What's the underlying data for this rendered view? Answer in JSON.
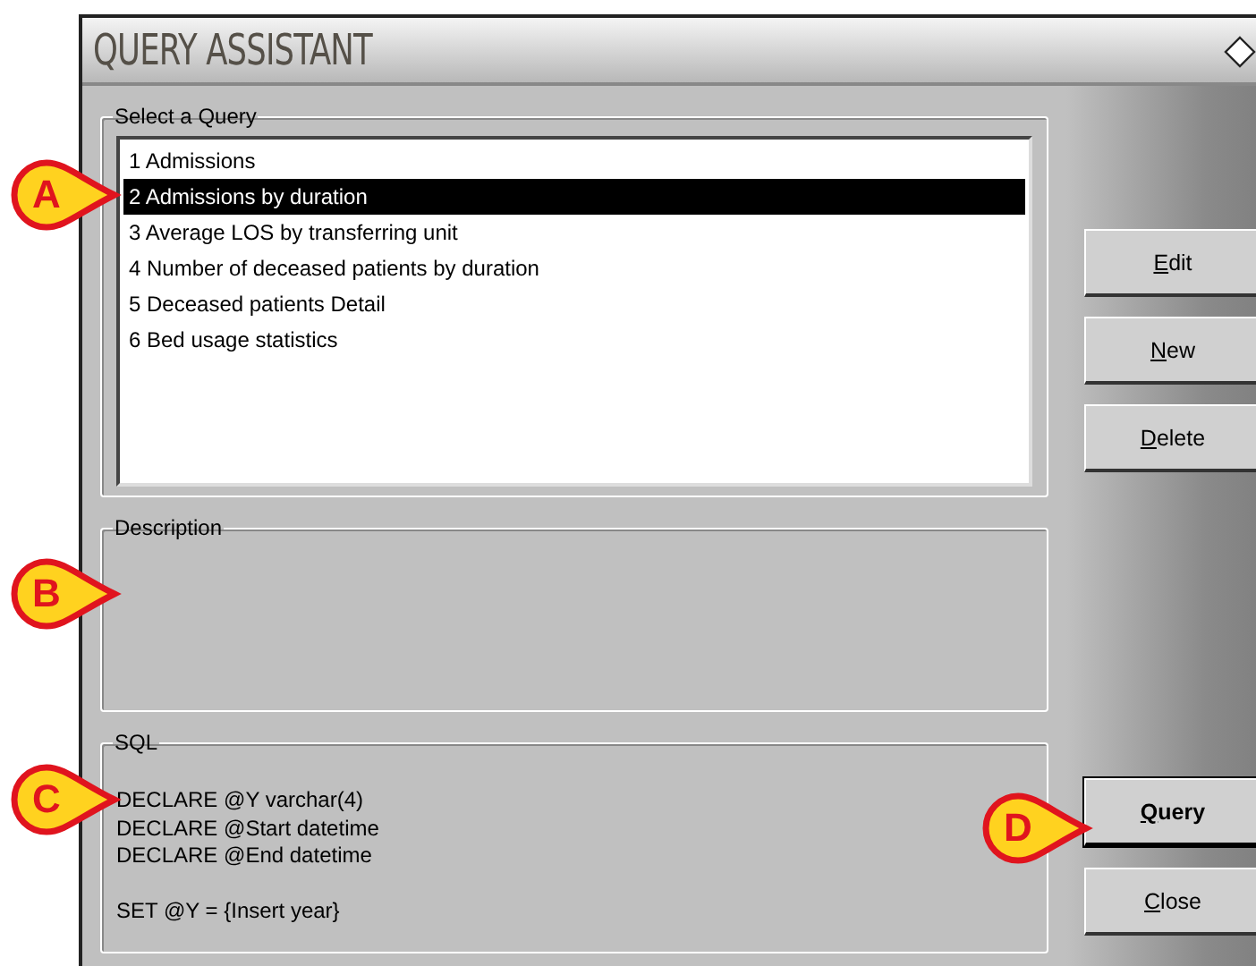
{
  "window": {
    "title": "QUERY ASSISTANT"
  },
  "query_list": {
    "label": "Select a Query",
    "items": [
      {
        "text": "1 Admissions",
        "selected": false
      },
      {
        "text": "2 Admissions by duration",
        "selected": true
      },
      {
        "text": "3 Average LOS by transferring unit",
        "selected": false
      },
      {
        "text": "4 Number of deceased patients by duration",
        "selected": false
      },
      {
        "text": "5 Deceased patients Detail",
        "selected": false
      },
      {
        "text": "6 Bed usage statistics",
        "selected": false
      }
    ]
  },
  "description": {
    "label": "Description"
  },
  "sql": {
    "label": "SQL",
    "blocks": [
      [
        "DECLARE @Y varchar(4)",
        "DECLARE @Start datetime",
        "DECLARE @End datetime"
      ],
      [
        "SET @Y = {Insert year}"
      ]
    ]
  },
  "side_buttons": [
    {
      "label": "Edit",
      "default": false
    },
    {
      "label": "New",
      "default": false
    },
    {
      "label": "Delete",
      "default": false
    }
  ],
  "bottom_buttons": [
    {
      "label": "Query",
      "default": true
    },
    {
      "label": "Close",
      "default": false
    }
  ],
  "callouts": [
    {
      "letter": "A"
    },
    {
      "letter": "B"
    },
    {
      "letter": "C"
    },
    {
      "letter": "D"
    }
  ]
}
